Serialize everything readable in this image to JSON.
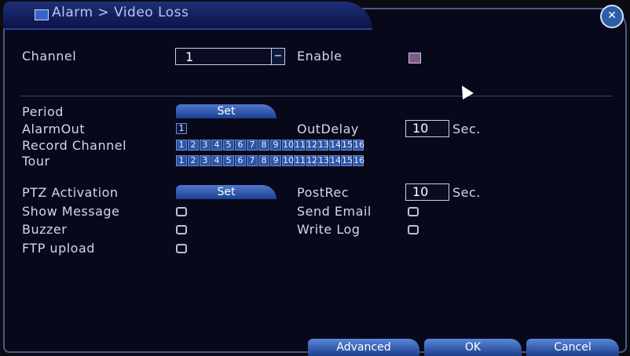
{
  "window": {
    "title": "Alarm > Video Loss"
  },
  "channel": {
    "label": "Channel",
    "value": "1",
    "enable_label": "Enable"
  },
  "fields": {
    "period_label": "Period",
    "set_label": "Set",
    "alarmout_label": "AlarmOut",
    "alarmout_value": "1",
    "outdelay_label": "OutDelay",
    "outdelay_value": "10",
    "outdelay_unit": "Sec.",
    "record_channel_label": "Record Channel",
    "record_channels": [
      "1",
      "2",
      "3",
      "4",
      "5",
      "6",
      "7",
      "8",
      "9",
      "10",
      "11",
      "12",
      "13",
      "14",
      "15",
      "16"
    ],
    "tour_label": "Tour",
    "tour_channels": [
      "1",
      "2",
      "3",
      "4",
      "5",
      "6",
      "7",
      "8",
      "9",
      "10",
      "11",
      "12",
      "13",
      "14",
      "15",
      "16"
    ],
    "ptz_label": "PTZ Activation",
    "ptz_set_label": "Set",
    "postrec_label": "PostRec",
    "postrec_value": "10",
    "postrec_unit": "Sec.",
    "show_message_label": "Show Message",
    "send_email_label": "Send Email",
    "buzzer_label": "Buzzer",
    "write_log_label": "Write Log",
    "ftp_upload_label": "FTP upload"
  },
  "buttons": {
    "advanced": "Advanced",
    "ok": "OK",
    "cancel": "Cancel"
  }
}
